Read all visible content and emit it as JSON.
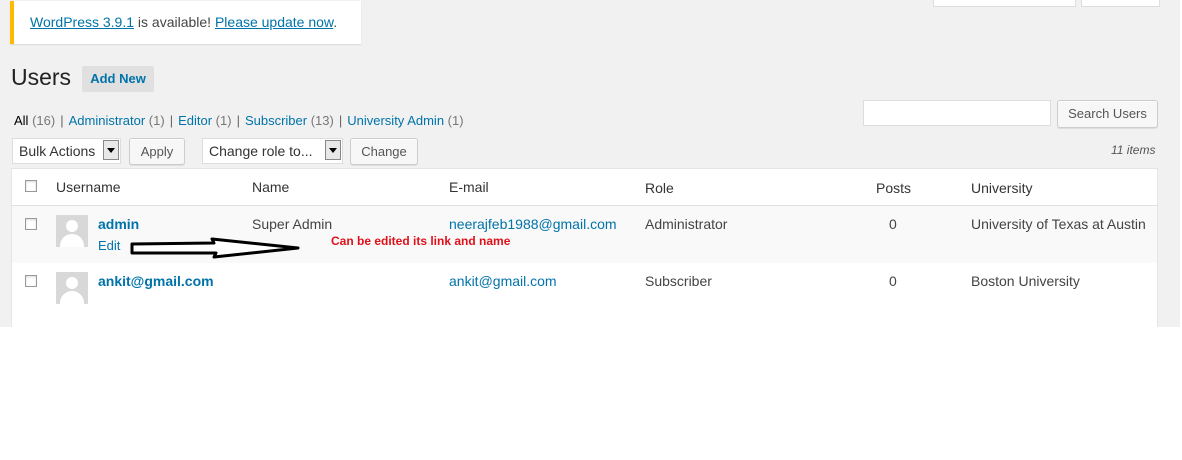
{
  "notice": {
    "version_link": "WordPress 3.9.1",
    "middle": " is available! ",
    "update_link": "Please update now",
    "end": "."
  },
  "header": {
    "title": "Users",
    "add_new": "Add New"
  },
  "views": [
    {
      "label": "All",
      "count": "(16)"
    },
    {
      "label": "Administrator",
      "count": "(1)"
    },
    {
      "label": "Editor",
      "count": "(1)"
    },
    {
      "label": "Subscriber",
      "count": "(13)"
    },
    {
      "label": "University Admin",
      "count": "(1)"
    }
  ],
  "search": {
    "value": "",
    "button": "Search Users"
  },
  "toolbar": {
    "bulk_actions": "Bulk Actions",
    "apply": "Apply",
    "change_role": "Change role to...",
    "change": "Change",
    "items": "11 items"
  },
  "table": {
    "columns": [
      "Username",
      "Name",
      "E-mail",
      "Role",
      "Posts",
      "University"
    ],
    "rows": [
      {
        "username": "admin",
        "action": "Edit",
        "name": "Super Admin",
        "email": "neerajfeb1988@gmail.com",
        "role": "Administrator",
        "posts": "0",
        "university": "University of Texas at Austin"
      },
      {
        "username": "ankit@gmail.com",
        "name": "",
        "email": "ankit@gmail.com",
        "role": "Subscriber",
        "posts": "0",
        "university": "Boston University"
      }
    ]
  },
  "annotation": {
    "text": "Can be edited its link and name",
    "color": "#e0101a"
  },
  "colors": {
    "link": "#0073aa",
    "notice_border": "#ffba00",
    "background": "#f1f1f1"
  }
}
